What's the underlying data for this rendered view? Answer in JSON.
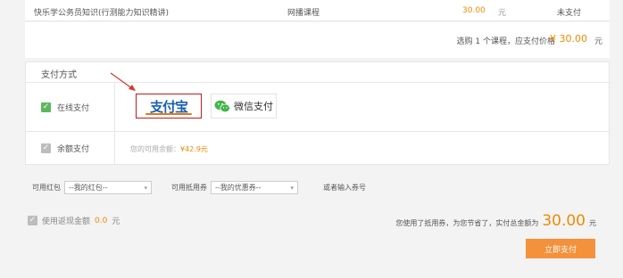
{
  "course": {
    "name": "快乐学公务员知识(行测能力知识精讲)",
    "type": "网播课程",
    "price": "30.00",
    "unit": "元",
    "status": "未支付"
  },
  "summary": {
    "text": "选购 1 个课程，应支付价格",
    "amount": "¥ 30.00",
    "unit": "元"
  },
  "payment": {
    "title": "支付方式",
    "online_label": "在线支付",
    "balance_label": "余额支付",
    "alipay_logo_text": "支付宝",
    "wechat_label": "微信支付",
    "balance_note_prefix": "您的可用余额：",
    "balance_amount": "¥42.9元"
  },
  "filters": {
    "redpacket_label": "可用红包",
    "redpacket_value": "--我的红包--",
    "coupon_label": "可用抵用券",
    "coupon_value": "--我的优惠券--",
    "coupon_code_hint": "或者输入券号"
  },
  "cashback": {
    "label": "使用返现金额",
    "amount": "0.0",
    "unit": "元"
  },
  "total": {
    "text": "您使用了抵用券，为您节省了，实付总金额为",
    "amount": "30.00",
    "unit": "元"
  },
  "pay_button": {
    "label": "立即支付"
  },
  "colors": {
    "accent": "#f08a00",
    "button": "#f4913b",
    "check_green": "#5cb85c",
    "alipay_blue": "#1a5fb4",
    "wechat_green": "#44b549",
    "arrow_red": "#d9342b"
  },
  "icons": {
    "check": "check-icon",
    "wechat": "wechat-icon",
    "chevron": "chevron-down-icon",
    "arrow": "annotation-arrow-icon"
  }
}
